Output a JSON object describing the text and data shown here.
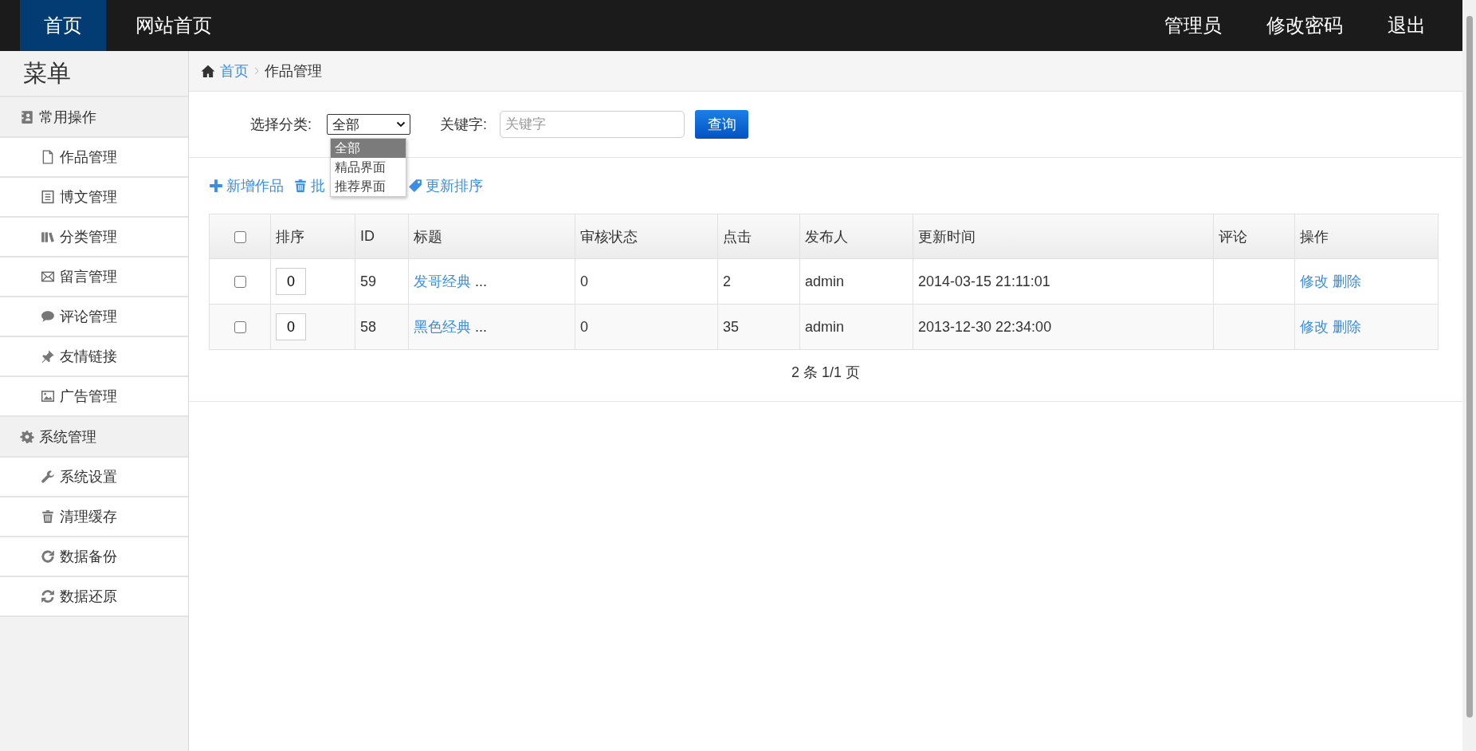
{
  "topnav": {
    "left": [
      {
        "label": "首页",
        "selected": true
      },
      {
        "label": "网站首页",
        "selected": false
      }
    ],
    "right": [
      "管理员",
      "修改密码",
      "退出"
    ]
  },
  "sidebar": {
    "title": "菜单",
    "sections": [
      {
        "label": "常用操作",
        "items": [
          "作品管理",
          "博文管理",
          "分类管理",
          "留言管理",
          "评论管理",
          "友情链接",
          "广告管理"
        ]
      },
      {
        "label": "系统管理",
        "items": [
          "系统设置",
          "清理缓存",
          "数据备份",
          "数据还原"
        ]
      }
    ]
  },
  "breadcrumb": {
    "home": "首页",
    "current": "作品管理"
  },
  "filter": {
    "category_label": "选择分类:",
    "category_value": "全部",
    "options": [
      {
        "label": "全部",
        "selected": true
      },
      {
        "label": "精品界面",
        "selected": false
      },
      {
        "label": "推荐界面",
        "selected": false
      }
    ],
    "keyword_label": "关键字:",
    "keyword_placeholder": "关键字",
    "search_button": "查询"
  },
  "actions": [
    "新增作品",
    "批",
    "更新排序"
  ],
  "table": {
    "header_checked": false,
    "columns": [
      "排序",
      "ID",
      "标题",
      "审核状态",
      "点击",
      "发布人",
      "更新时间",
      "评论",
      "操作"
    ],
    "rows": [
      {
        "checked": false,
        "sort": "0",
        "id": "59",
        "title": "发哥经典",
        "title_suffix": "...",
        "status": "0",
        "clicks": "2",
        "publisher": "admin",
        "updated": "2014-03-15 21:11:01",
        "ops": [
          "修改",
          "删除"
        ]
      },
      {
        "checked": false,
        "sort": "0",
        "id": "58",
        "title": "黑色经典",
        "title_suffix": "...",
        "status": "0",
        "clicks": "35",
        "publisher": "admin",
        "updated": "2013-12-30 22:34:00",
        "ops": [
          "修改",
          "删除"
        ]
      }
    ]
  },
  "pagination": "2 条 1/1 页"
}
